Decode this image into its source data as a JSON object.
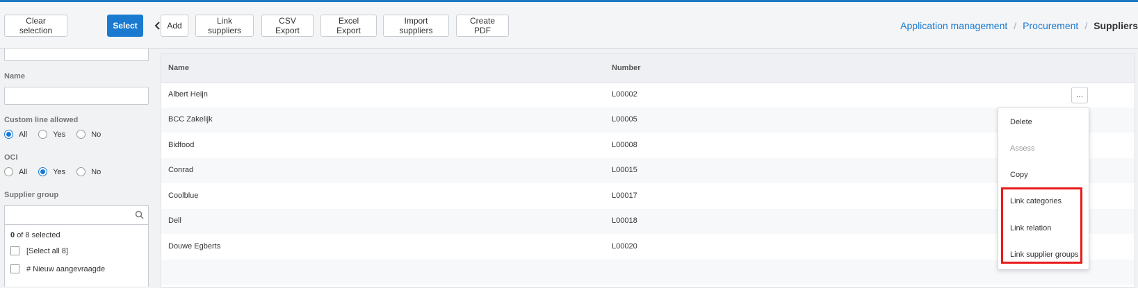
{
  "toolbar": {
    "clear_selection": "Clear selection",
    "select": "Select",
    "add": "Add",
    "link_suppliers": "Link suppliers",
    "csv_export": "CSV Export",
    "excel_export": "Excel Export",
    "import_suppliers": "Import suppliers",
    "create_pdf": "Create PDF"
  },
  "breadcrumb": {
    "items": [
      "Application management",
      "Procurement"
    ],
    "separator": "/",
    "current": "Suppliers"
  },
  "filters": {
    "name_label": "Name",
    "name_value": "",
    "custom_line_label": "Custom line allowed",
    "custom_line_options": [
      "All",
      "Yes",
      "No"
    ],
    "custom_line_selected": "All",
    "oci_label": "OCI",
    "oci_options": [
      "All",
      "Yes",
      "No"
    ],
    "oci_selected": "Yes",
    "supplier_group_label": "Supplier group",
    "supplier_group_search": "",
    "selected_count": "0",
    "selected_text": "of 8 selected",
    "select_all": "[Select all 8]",
    "partial_item": "# Nieuw aangevraagde"
  },
  "table": {
    "columns": [
      "Name",
      "Number"
    ],
    "rows": [
      {
        "name": "Albert Heijn",
        "number": "L00002"
      },
      {
        "name": "BCC Zakelijk",
        "number": "L00005"
      },
      {
        "name": "Bidfood",
        "number": "L00008"
      },
      {
        "name": "Conrad",
        "number": "L00015"
      },
      {
        "name": "Coolblue",
        "number": "L00017"
      },
      {
        "name": "Dell",
        "number": "L00018"
      },
      {
        "name": "Douwe Egberts",
        "number": "L00020"
      }
    ],
    "row_menu_label": "…"
  },
  "context_menu": {
    "items": [
      "Delete",
      "Assess",
      "Copy",
      "Link categories",
      "Link relation",
      "Link supplier groups"
    ],
    "disabled": [
      "Assess"
    ]
  },
  "colors": {
    "accent": "#1a7ad0",
    "highlight": "#e81a1a"
  }
}
